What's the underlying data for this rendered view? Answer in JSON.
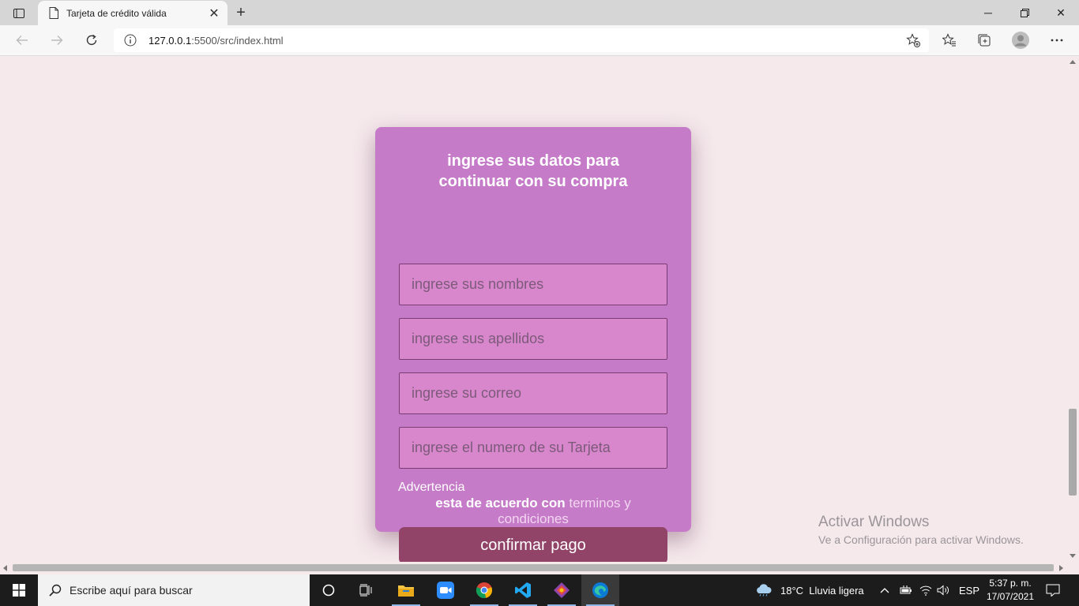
{
  "browser": {
    "tab_title": "Tarjeta de crédito válida",
    "url_host": "127.0.0.1",
    "url_rest": ":5500/src/index.html"
  },
  "form": {
    "heading": "ingrese sus datos para continuar con su compra",
    "fields": [
      {
        "placeholder": "ingrese sus nombres"
      },
      {
        "placeholder": "ingrese sus apellidos"
      },
      {
        "placeholder": "ingrese su correo"
      },
      {
        "placeholder": "ingrese el numero de su Tarjeta"
      }
    ],
    "warning_title": "Advertencia",
    "warning_text": "esta de acuerdo con",
    "warning_link": "terminos y condiciones",
    "submit_label": "confirmar pago"
  },
  "watermark": {
    "title": "Activar Windows",
    "subtitle": "Ve a Configuración para activar Windows."
  },
  "taskbar": {
    "search_placeholder": "Escribe aquí para buscar",
    "weather": "18°C  Lluvia ligera",
    "language": "ESP",
    "time": "5:37 p. m.",
    "date": "17/07/2021"
  },
  "colors": {
    "page_bg": "#f5e9ec",
    "card_bg": "#c57bc8",
    "field_bg": "#d987cc",
    "button_bg": "#924468"
  }
}
